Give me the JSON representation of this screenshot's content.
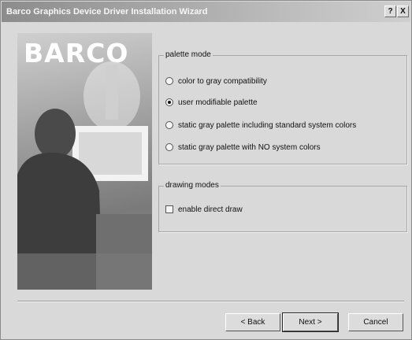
{
  "window": {
    "title": "Barco Graphics Device Driver Installation Wizard",
    "help_label": "?",
    "close_label": "X"
  },
  "banner": {
    "logo_text": "BARCO"
  },
  "palette_mode": {
    "label": "palette mode",
    "options": [
      {
        "label": "color to gray compatibility",
        "selected": false
      },
      {
        "label": "user modifiable palette",
        "selected": true
      },
      {
        "label": "static gray palette including standard system colors",
        "selected": false
      },
      {
        "label": "static gray palette with NO system colors",
        "selected": false
      }
    ]
  },
  "drawing_modes": {
    "label": "drawing modes",
    "enable_direct_draw": {
      "label": "enable direct draw",
      "checked": false
    }
  },
  "buttons": {
    "back": "< Back",
    "next": "Next >",
    "cancel": "Cancel"
  }
}
